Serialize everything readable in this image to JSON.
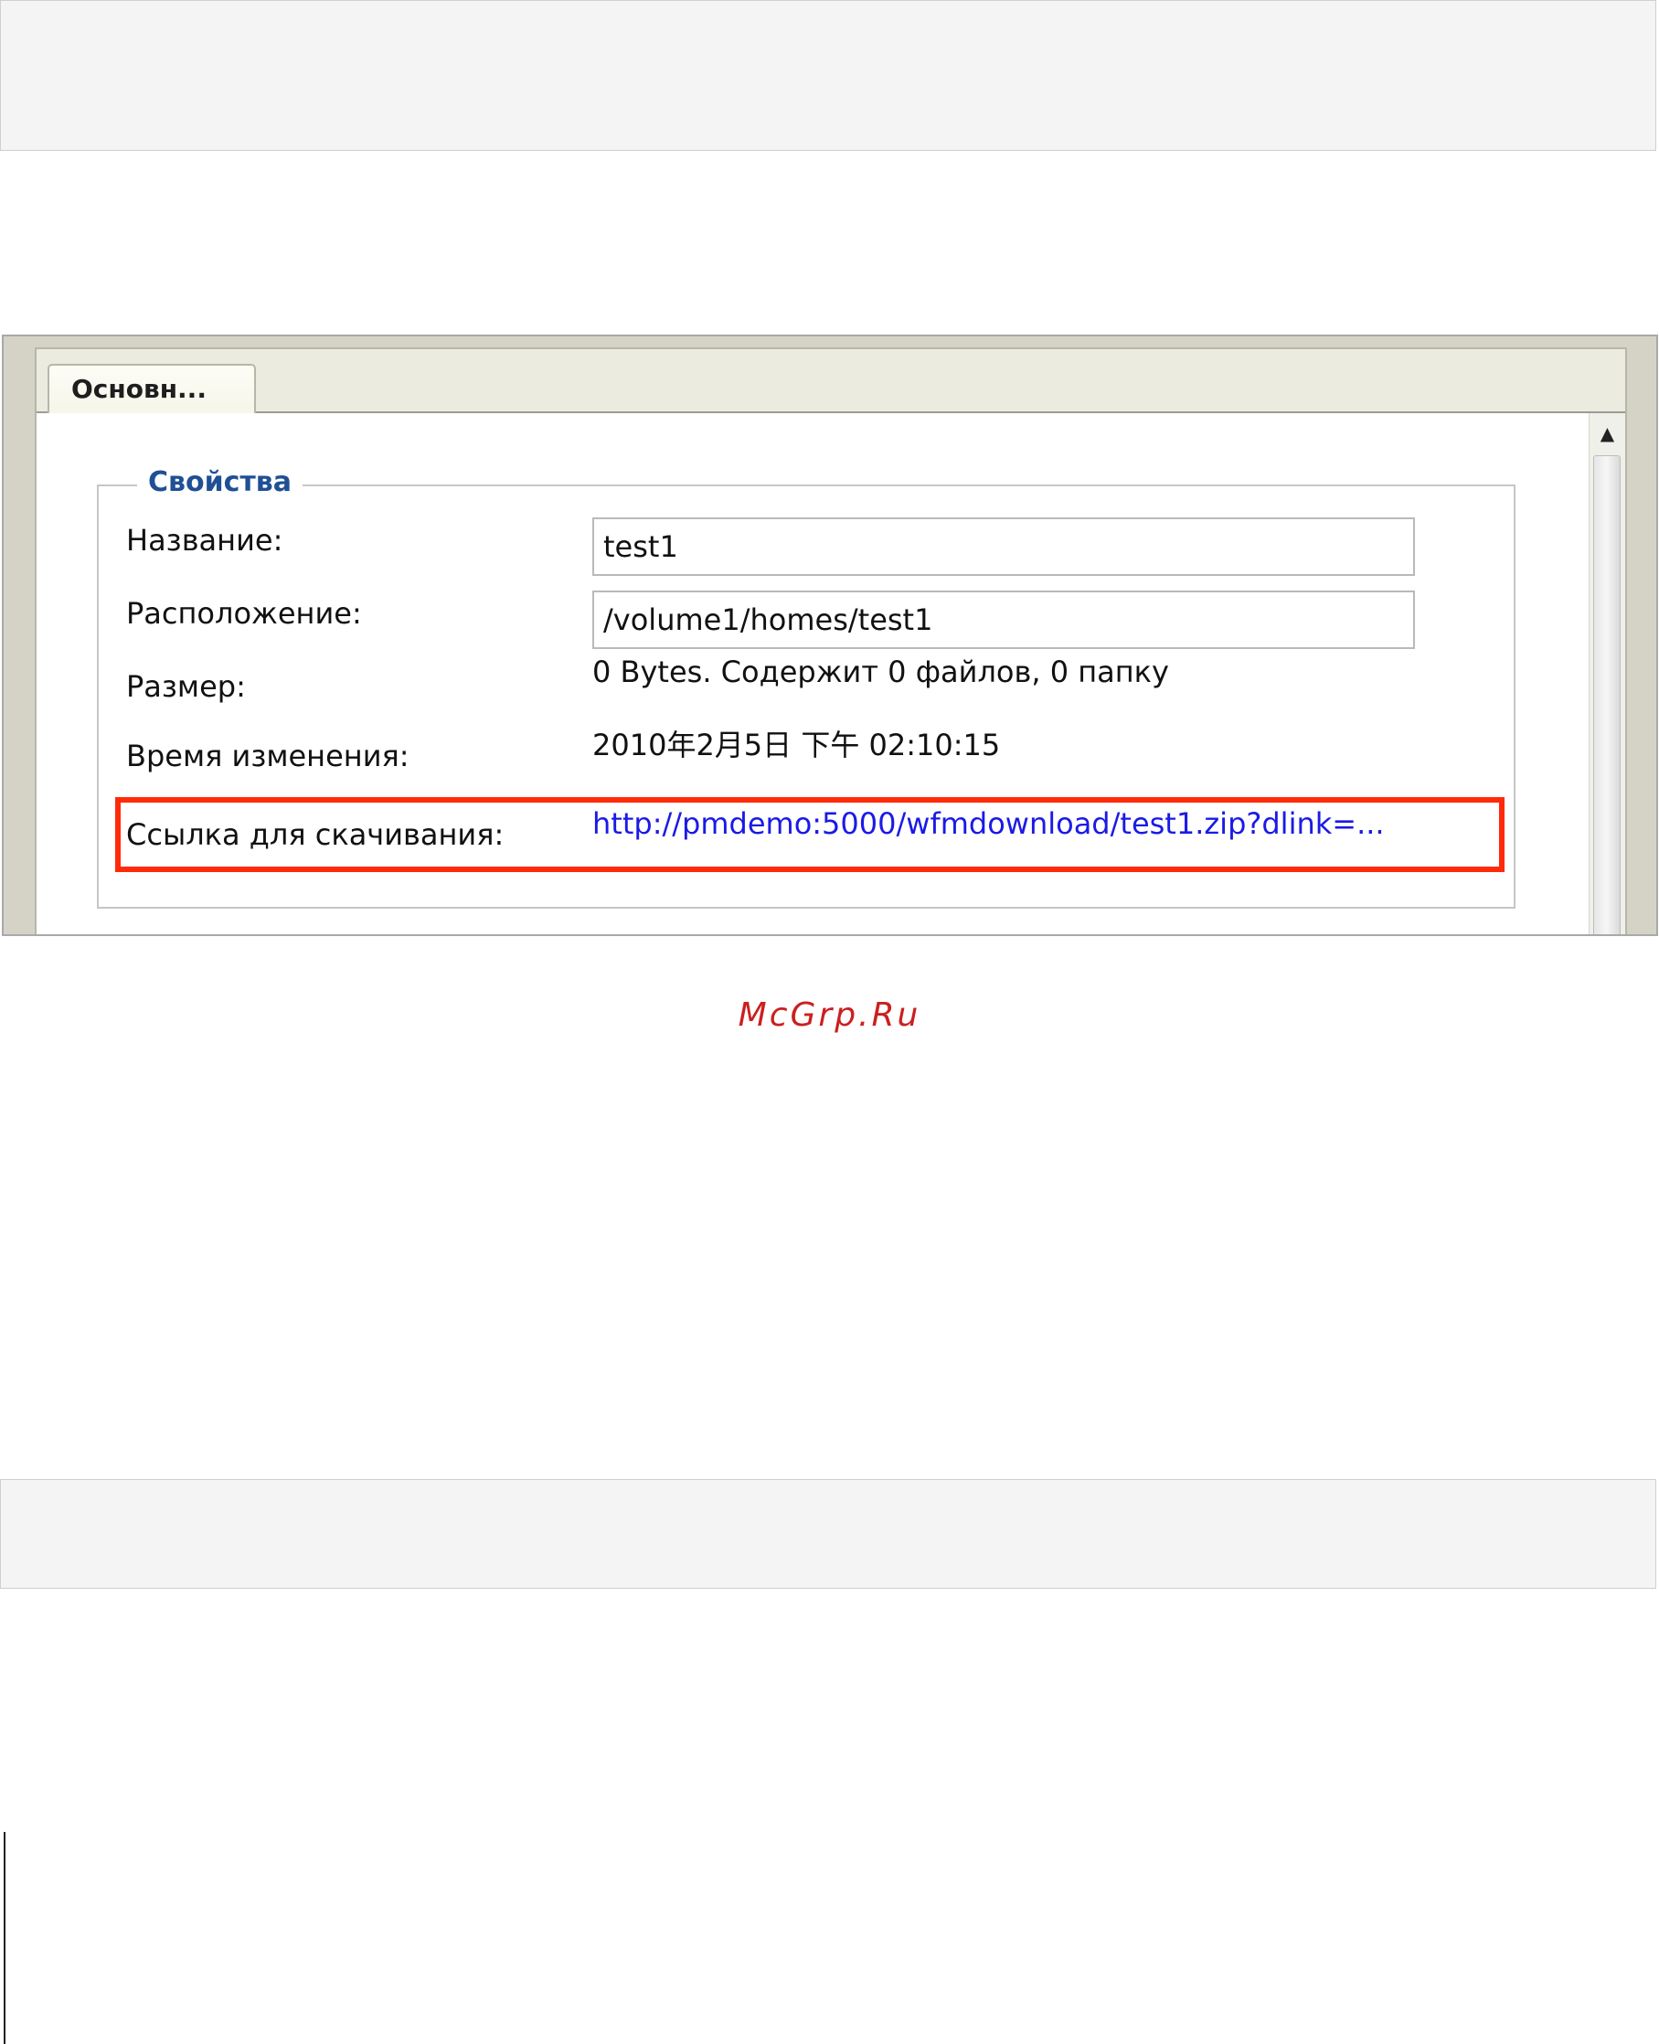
{
  "dialog": {
    "tab_label": "Основн...",
    "scroll_up_glyph": "▲",
    "fieldset": {
      "legend": "Свойства",
      "name_label": "Название:",
      "name_value": "test1",
      "location_label": "Расположение:",
      "location_value": "/volume1/homes/test1",
      "size_label": "Размер:",
      "size_value": "0 Bytes. Содержит 0 файлов, 0 папку",
      "modified_label": "Время изменения:",
      "modified_value": "2010年2月5日 下午 02:10:15",
      "download_label": "Ссылка для скачивания:",
      "download_link": "http://pmdemo:5000/wfmdownload/test1.zip?dlink=..."
    },
    "highlight_color": "#ff2a0a"
  },
  "watermark": "McGrp.Ru"
}
